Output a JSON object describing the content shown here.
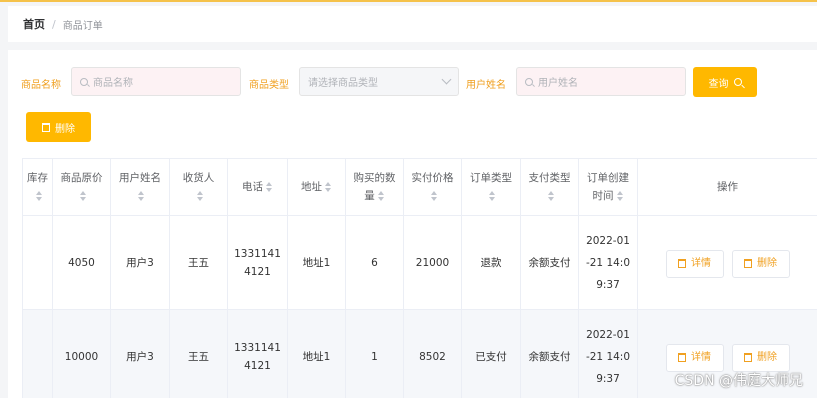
{
  "breadcrumb": {
    "home": "首页",
    "sep": "/",
    "current": "商品订单"
  },
  "filters": {
    "product_name_label": "商品名称",
    "product_name_placeholder": "商品名称",
    "product_type_label": "商品类型",
    "product_type_placeholder": "请选择商品类型",
    "user_name_label": "用户姓名",
    "user_name_placeholder": "用户姓名",
    "search_button": "查询",
    "delete_button": "删除"
  },
  "table": {
    "columns": [
      "库存",
      "商品原价",
      "用户姓名",
      "收货人",
      "电话",
      "地址",
      "购买的数量",
      "实付价格",
      "订单类型",
      "支付类型",
      "订单创建时间",
      "操作"
    ],
    "column_line1": [
      "库存",
      "商品原价",
      "用户姓名",
      "收货人",
      "电话",
      "地址",
      "购买的数",
      "实付价格",
      "订单类型",
      "支付类型",
      "订单创建",
      "操作"
    ],
    "column_line2": [
      "",
      "",
      "",
      "",
      "",
      "",
      "量",
      "",
      "",
      "",
      "时间",
      ""
    ],
    "rows": [
      {
        "stock": "",
        "original_price": "4050",
        "user_name": "用户3",
        "receiver": "王五",
        "phone1": "1331141",
        "phone2": "4121",
        "address": "地址1",
        "quantity": "6",
        "paid": "21000",
        "order_type": "退款",
        "pay_type": "余额支付",
        "time1": "2022-01",
        "time2": "-21 14:0",
        "time3": "9:37",
        "detail_btn": "详情",
        "delete_btn": "删除"
      },
      {
        "stock": "",
        "original_price": "10000",
        "user_name": "用户3",
        "receiver": "王五",
        "phone1": "1331141",
        "phone2": "4121",
        "address": "地址1",
        "quantity": "1",
        "paid": "8502",
        "order_type": "已支付",
        "pay_type": "余额支付",
        "time1": "2022-01",
        "time2": "-21 14:0",
        "time3": "9:37",
        "detail_btn": "详情",
        "delete_btn": "删除"
      }
    ]
  },
  "watermark": "CSDN @伟庭大师兄",
  "colors": {
    "accent": "#ffb800",
    "label": "#f0a020"
  }
}
